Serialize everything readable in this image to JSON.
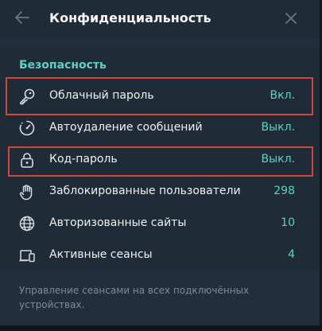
{
  "header": {
    "title": "Конфиденциальность",
    "back_icon": "arrow-left-icon",
    "close_icon": "close-icon"
  },
  "section": {
    "title": "Безопасность"
  },
  "rows": [
    {
      "label": "Облачный пароль",
      "value": "Вкл.",
      "icon": "key-icon",
      "highlighted": true
    },
    {
      "label": "Автоудаление сообщений",
      "value": "Выкл.",
      "icon": "timer-icon",
      "highlighted": false
    },
    {
      "label": "Код-пароль",
      "value": "Выкл.",
      "icon": "lock-icon",
      "highlighted": true
    },
    {
      "label": "Заблокированные пользователи",
      "value": "298",
      "icon": "hand-icon",
      "highlighted": false
    },
    {
      "label": "Авторизованные сайты",
      "value": "10",
      "icon": "globe-icon",
      "highlighted": false
    },
    {
      "label": "Активные сеансы",
      "value": "4",
      "icon": "devices-icon",
      "highlighted": false
    }
  ],
  "footer": {
    "text": "Управление сеансами на всех подключённых устройствах."
  },
  "colors": {
    "accent": "#5fd1c4",
    "highlight": "#d0473c",
    "background": "#1f2b37"
  }
}
